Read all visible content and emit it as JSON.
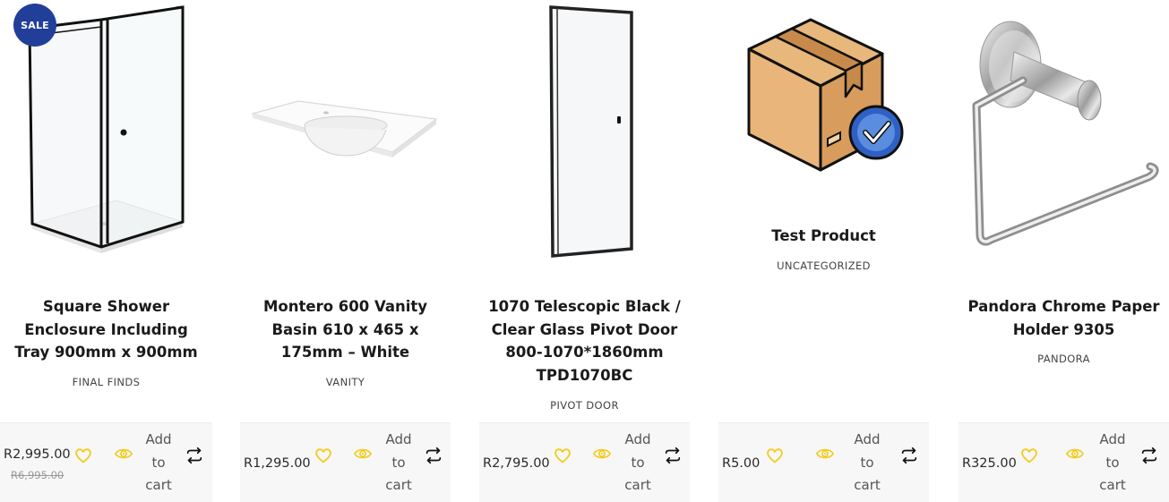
{
  "products": [
    {
      "sale_badge": "SALE",
      "title_lines": [
        "Square Shower",
        "Enclosure Including",
        "Tray 900mm x 900mm"
      ],
      "category": "FINAL FINDS",
      "price": "R2,995.00",
      "old_price": "R6,995.00",
      "add_to_cart": [
        "Add",
        "to",
        "cart"
      ],
      "image": "shower-enclosure"
    },
    {
      "title_lines": [
        "Montero 600 Vanity",
        "Basin 610 x 465 x",
        "175mm – White"
      ],
      "category": "VANITY",
      "price": "R1,295.00",
      "add_to_cart": [
        "Add",
        "to",
        "cart"
      ],
      "image": "vanity-basin"
    },
    {
      "title_lines": [
        "1070 Telescopic Black /",
        "Clear Glass Pivot Door",
        "800-1070*1860mm",
        "TPD1070BC"
      ],
      "category": "PIVOT DOOR",
      "price": "R2,795.00",
      "add_to_cart": [
        "Add",
        "to",
        "cart"
      ],
      "image": "pivot-door"
    },
    {
      "title_lines": [
        "Test Product"
      ],
      "category": "UNCATEGORIZED",
      "price": "R5.00",
      "add_to_cart": [
        "Add",
        "to",
        "cart"
      ],
      "image": "box-placeholder"
    },
    {
      "title_lines": [
        "Pandora Chrome Paper",
        "Holder 9305"
      ],
      "category": "PANDORA",
      "price": "R325.00",
      "add_to_cart": [
        "Add",
        "to",
        "cart"
      ],
      "image": "paper-holder"
    }
  ],
  "icons": {
    "wishlist": "heart-icon",
    "quickview": "eye-icon",
    "compare": "compare-arrows-icon"
  },
  "colors": {
    "sale_badge": "#213f99",
    "icon_yellow": "#f2cc1e",
    "footer_bg": "#f7f7f7"
  }
}
